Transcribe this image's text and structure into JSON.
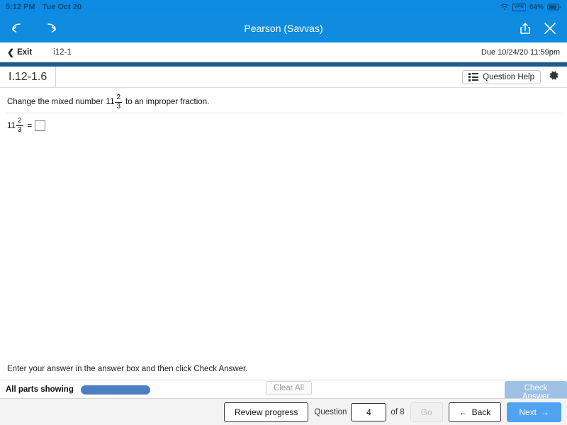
{
  "status_bar": {
    "time": "5:12 PM",
    "date": "Tue Oct 20",
    "vpn_label": "VPN",
    "battery_percent": "64%"
  },
  "app_bar": {
    "title": "Pearson (Savvas)",
    "back_icon": "back-arrow-icon",
    "forward_icon": "forward-arrow-icon",
    "share_icon": "share-icon",
    "close_icon": "close-icon"
  },
  "sub_header": {
    "exit_label": "Exit",
    "assignment_id": "i12-1",
    "due_text": "Due 10/24/20 11:59pm"
  },
  "question_header": {
    "title": "I.12-1.6",
    "help_label": "Question Help",
    "settings_icon": "gear-icon"
  },
  "question": {
    "prompt_before": "Change the mixed number",
    "whole": "11",
    "numerator": "2",
    "denominator": "3",
    "prompt_after": "to an improper fraction.",
    "answer_whole": "11",
    "answer_numerator": "2",
    "answer_denominator": "3",
    "equals": "=",
    "answer_value": ""
  },
  "footer": {
    "instruction": "Enter your answer in the answer box and then click Check Answer.",
    "parts_label": "All parts showing",
    "clear_all_label": "Clear All",
    "check_answer_label": "Check Answer"
  },
  "bottom_nav": {
    "review_label": "Review progress",
    "question_label": "Question",
    "question_number": "4",
    "of_label": "of 8",
    "go_label": "Go",
    "back_label": "Back",
    "next_label": "Next"
  },
  "colors": {
    "status_bar_blue": "#0d8ae3",
    "app_bar_blue": "#0f8ce0",
    "dark_rule_blue": "#1f5b8f",
    "progress_blue": "#4a7fc1",
    "next_blue": "#4fa3f0",
    "check_answer_blue": "#9dc0e4",
    "answer_box_border": "#6f90a0"
  }
}
